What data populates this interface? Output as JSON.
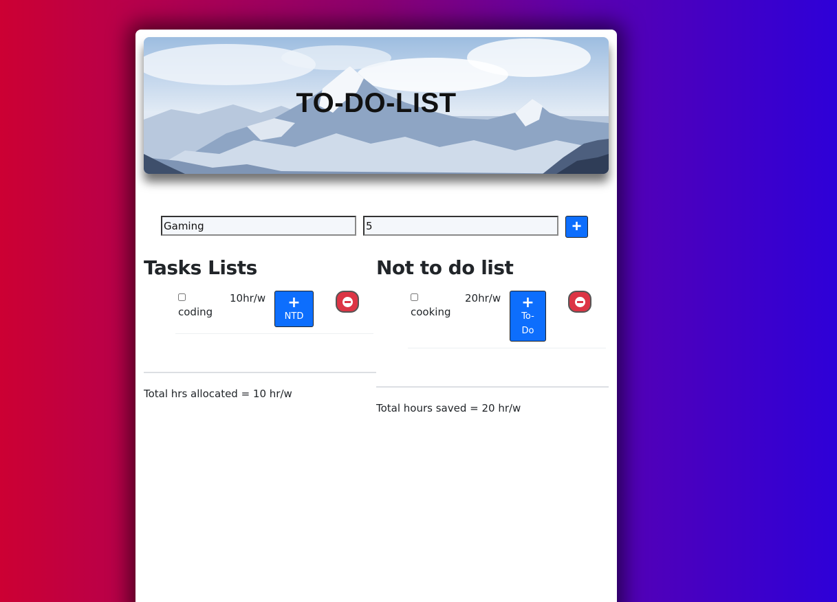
{
  "header": {
    "title": "TO-DO-LIST"
  },
  "form": {
    "task_value": "Gaming",
    "hours_value": "5",
    "add_icon": "plus-icon",
    "add_label": "+"
  },
  "tasks_list": {
    "heading": "Tasks Lists",
    "items": [
      {
        "name": "coding",
        "hours": "10hr/w",
        "checked": false,
        "move_label": "NTD",
        "move_icon": "plus-icon",
        "delete_icon": "minus-circle-icon"
      }
    ],
    "total_text": "Total hrs allocated = 10 hr/w"
  },
  "not_to_do_list": {
    "heading": "Not to do list",
    "items": [
      {
        "name": "cooking",
        "hours": "20hr/w",
        "checked": false,
        "move_label_line1": "To-",
        "move_label_line2": "Do",
        "move_icon": "plus-icon",
        "delete_icon": "minus-circle-icon"
      }
    ],
    "total_text": "Total hours saved = 20 hr/w"
  },
  "colors": {
    "primary": "#0d6efd",
    "danger": "#dc3545",
    "background_start": "#cc0033",
    "background_end": "#2e00d8"
  }
}
